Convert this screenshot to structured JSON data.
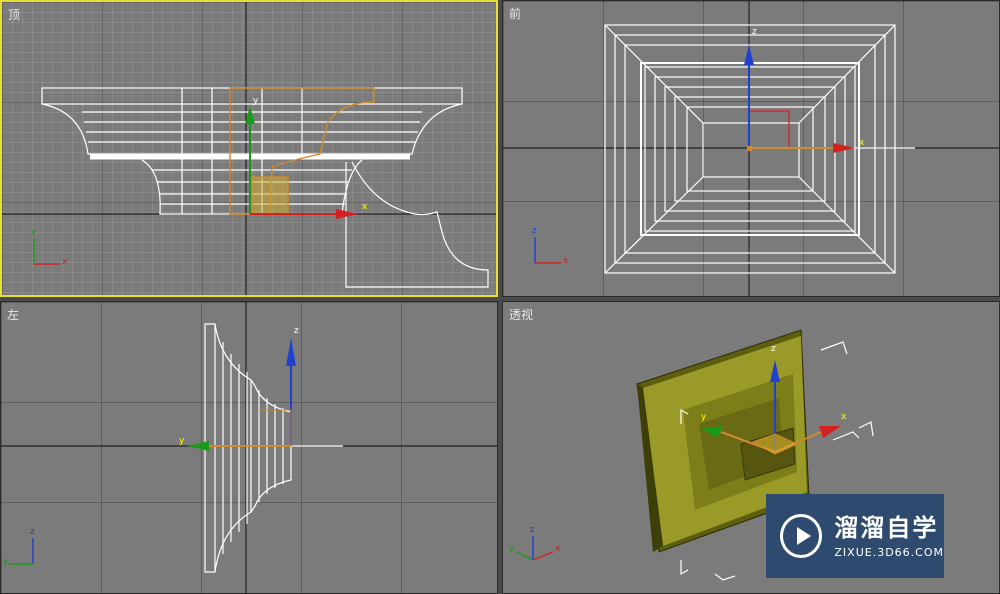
{
  "viewports": {
    "top": {
      "label": "顶"
    },
    "front": {
      "label": "前"
    },
    "left": {
      "label": "左"
    },
    "perspective": {
      "label": "透视"
    }
  },
  "gizmo_axes": {
    "x": "x",
    "y": "y",
    "z": "z"
  },
  "watermark": {
    "title": "溜溜自学",
    "url": "ZIXUE.3D66.COM"
  },
  "colors": {
    "viewport_bg": "#7b7b7b",
    "active_border": "#e6e035",
    "wire": "#ffffff",
    "gizmo_x": "#d42020",
    "gizmo_y": "#1a9a1a",
    "gizmo_z": "#2040d0",
    "selection_orange": "#d08a30",
    "model_olive": "#8c8c1e"
  }
}
